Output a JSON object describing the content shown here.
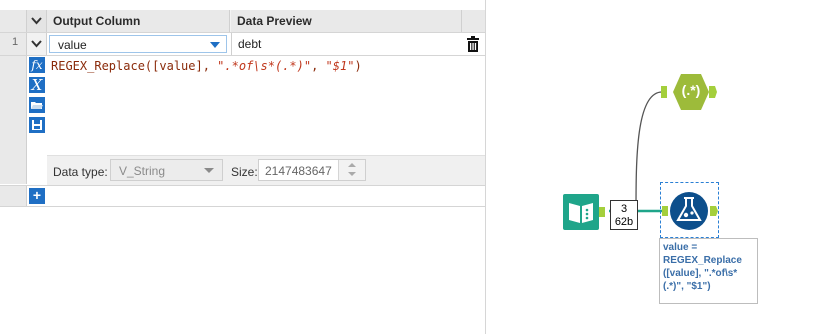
{
  "grid": {
    "headers": {
      "output_column": "Output Column",
      "data_preview": "Data Preview"
    },
    "row": {
      "number": "1",
      "field": "value",
      "preview": "debt"
    }
  },
  "expression": {
    "prefix": "REGEX_Replace([value], ",
    "pattern": "\".*of\\s*(.*)\"",
    "sep": ", ",
    "replacement": "\"$1\"",
    "suffix": ")"
  },
  "toolbar_icons": [
    "fx-icon",
    "variable-x-icon",
    "open-folder-icon",
    "save-icon"
  ],
  "settings": {
    "data_type_label": "Data type:",
    "data_type_value": "V_String",
    "size_label": "Size:",
    "size_value": "2147483647"
  },
  "add_row": {
    "label": "+"
  },
  "canvas": {
    "regex_tool_label": "(.*)",
    "connection_count": "3",
    "connection_size": "62b",
    "annotation_lines": [
      "value =",
      "REGEX_Replace",
      "([value], \".*of\\s*",
      "(.*)\", \"$1\")"
    ]
  },
  "colors": {
    "accent": "#1f6fc4",
    "regex_tool": "#9dbb3a",
    "input_tool": "#1fa58a",
    "formula_tool": "#0d4f8c"
  }
}
